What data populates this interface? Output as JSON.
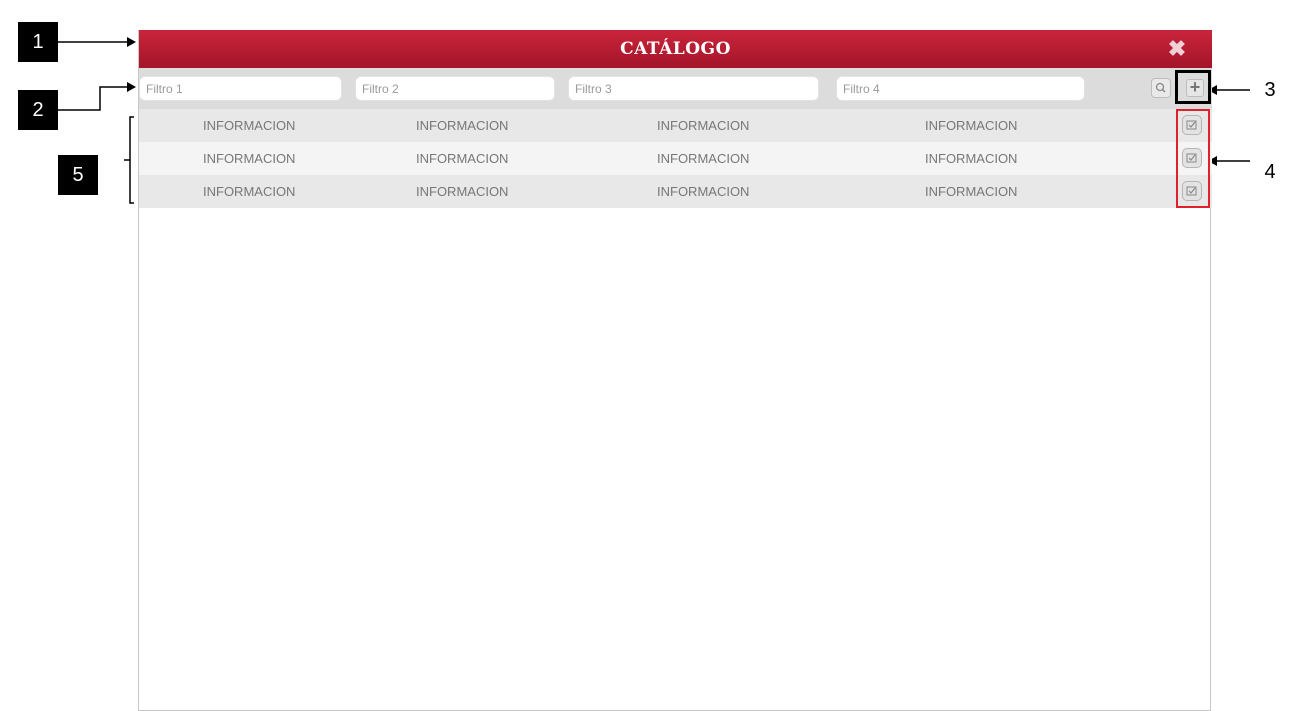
{
  "callouts": {
    "c1": "1",
    "c2": "2",
    "c3": "3",
    "c4": "4",
    "c5": "5"
  },
  "window": {
    "title": "CATÁLOGO",
    "close_glyph": "✖"
  },
  "filters": [
    {
      "placeholder": "Filtro 1"
    },
    {
      "placeholder": "Filtro 2"
    },
    {
      "placeholder": "Filtro 3"
    },
    {
      "placeholder": "Filtro 4"
    }
  ],
  "add_glyph": "+",
  "rows": [
    {
      "cells": [
        "INFORMACION",
        "INFORMACION",
        "INFORMACION",
        "INFORMACION"
      ]
    },
    {
      "cells": [
        "INFORMACION",
        "INFORMACION",
        "INFORMACION",
        "INFORMACION"
      ]
    },
    {
      "cells": [
        "INFORMACION",
        "INFORMACION",
        "INFORMACION",
        "INFORMACION"
      ]
    }
  ],
  "colors": {
    "title_bar": "#b61d33",
    "filter_bar": "#dcdcdc",
    "highlight": "#e0202a"
  },
  "icons": {
    "close": "close-icon",
    "search": "search-icon",
    "add": "plus-icon",
    "row_action": "checkbox-icon"
  }
}
